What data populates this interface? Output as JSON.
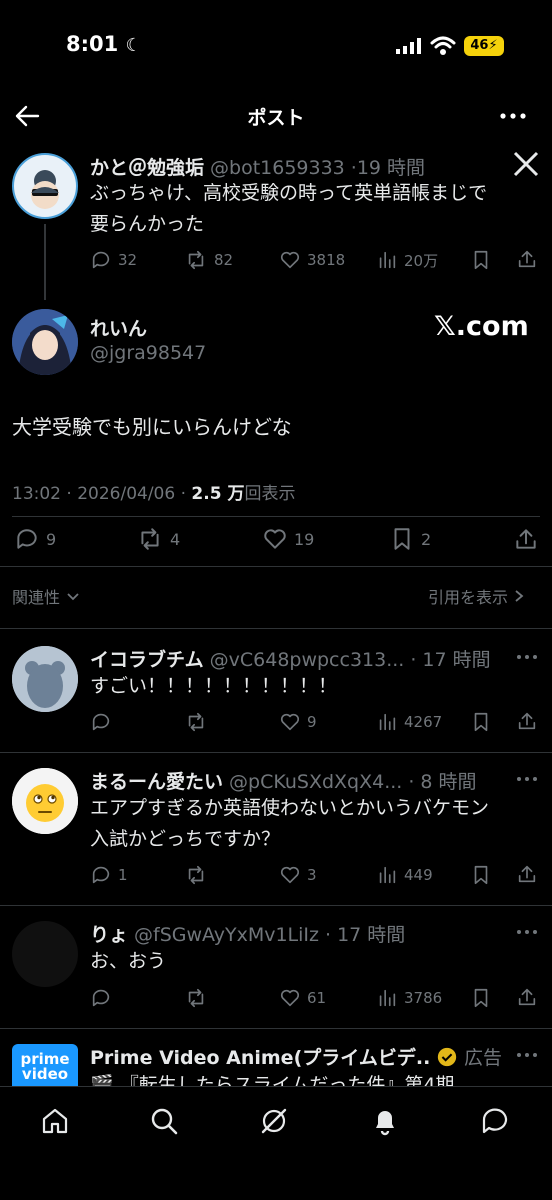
{
  "status_bar": {
    "time": "8:01",
    "battery": "46"
  },
  "header": {
    "title": "ポスト"
  },
  "quoted_tweet": {
    "name": "かと＠勉強垢",
    "handle": "@bot1659333",
    "time": "19 時間",
    "text_line1": "ぶっちゃけ、高校受験の時って英単語帳まじで",
    "text_line2": "要らんかった",
    "metrics": {
      "replies": "32",
      "reposts": "82",
      "likes": "3818",
      "views": "20万"
    }
  },
  "main_tweet": {
    "name": "れいん",
    "handle": "@jgra98547",
    "watermark": "𝕏.com",
    "text": "大学受験でも別にいらんけどな",
    "datetime": "13:02 · 2026/04/06 ·",
    "view_count": "2.5 万",
    "view_label": "回表示",
    "metrics": {
      "replies": "9",
      "reposts": "4",
      "likes": "19",
      "bookmarks": "2"
    }
  },
  "sort_bar": {
    "relevance": "関連性",
    "quotes": "引用を表示"
  },
  "replies": [
    {
      "name": "イコラブチム",
      "handle": "@vC648pwpcc313...",
      "time": "· 17 時間",
      "text": "すごい！！！！！！！！！！",
      "replies": "",
      "reposts": "",
      "likes": "9",
      "views": "4267"
    },
    {
      "name": "まるーん愛たい",
      "handle": "@pCKuSXdXqX4...",
      "time": "· 8 時間",
      "text_line1": "エアプすぎるか英語使わないとかいうバケモン",
      "text_line2": "入試かどっちですか？",
      "replies": "1",
      "reposts": "",
      "likes": "3",
      "views": "449"
    },
    {
      "name": "りょ",
      "handle": "@fSGwAyYxMv1LiIz",
      "time": "· 17 時間",
      "text": "お、おう",
      "replies": "",
      "reposts": "",
      "likes": "61",
      "views": "3786"
    }
  ],
  "ad": {
    "name": "Prime Video Anime(プライムビデ...",
    "label": "広告",
    "text": "🎬 『転生したらスライムだった件』第4期",
    "logo_line1": "prime",
    "logo_line2": "video"
  },
  "colors": {
    "background": "#000000",
    "text": "#e7e9ea",
    "muted": "#71767b",
    "divider": "#2f3336",
    "verified": "#e2b719"
  }
}
